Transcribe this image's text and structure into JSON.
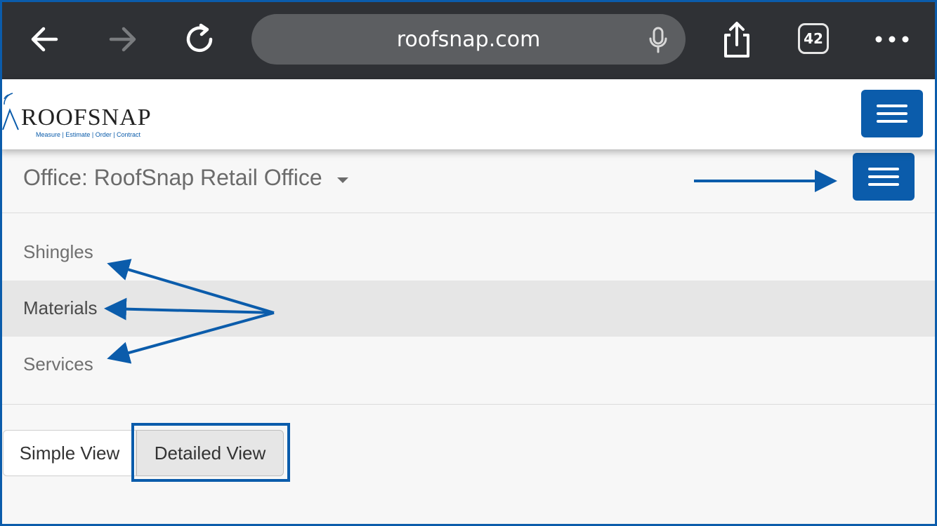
{
  "browser": {
    "url": "roofsnap.com",
    "tab_count": "42",
    "icons": [
      "back-arrow-icon",
      "forward-arrow-icon",
      "reload-icon",
      "microphone-icon",
      "share-icon",
      "tabs-icon",
      "more-icon"
    ]
  },
  "header": {
    "logo_text": "ROOFSNAP",
    "logo_tagline": "Measure | Estimate | Order | Contract"
  },
  "office": {
    "label": "Office: RoofSnap Retail Office"
  },
  "nav_items": [
    {
      "label": "Shingles",
      "active": false
    },
    {
      "label": "Materials",
      "active": true
    },
    {
      "label": "Services",
      "active": false
    }
  ],
  "view_toggle": {
    "simple_label": "Simple View",
    "detailed_label": "Detailed View",
    "selected": "Detailed View"
  },
  "colors": {
    "brand_blue": "#0b5cab",
    "browser_bar": "#2f3135",
    "annotation": "#0b5cab"
  }
}
